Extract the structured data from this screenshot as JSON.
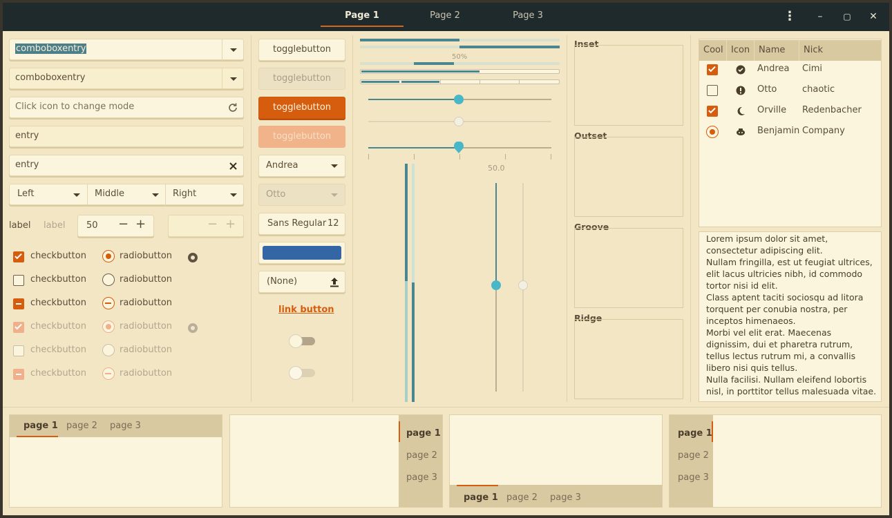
{
  "header": {
    "tabs": [
      {
        "label": "Page 1"
      },
      {
        "label": "Page 2"
      },
      {
        "label": "Page 3"
      }
    ],
    "controls": {
      "menu": "⋮",
      "minimize": "–",
      "maximize": "▢",
      "close": "✕"
    }
  },
  "left": {
    "combo1": "comboboxentry",
    "combo2": "comboboxentry",
    "mode_placeholder": "Click icon to change mode",
    "entry1": "entry",
    "entry2": "entry",
    "seg": [
      "Left",
      "Middle",
      "Right"
    ],
    "label1": "label",
    "label2": "label",
    "spin_value": "50",
    "checks": [
      {
        "label": "checkbutton",
        "state": "checked"
      },
      {
        "label": "checkbutton",
        "state": "unchecked"
      },
      {
        "label": "checkbutton",
        "state": "mixed"
      },
      {
        "label": "checkbutton",
        "state": "checked-disabled"
      },
      {
        "label": "checkbutton",
        "state": "unchecked-disabled"
      },
      {
        "label": "checkbutton",
        "state": "mixed-disabled"
      }
    ],
    "radios": [
      {
        "label": "radiobutton"
      },
      {
        "label": "radiobutton"
      },
      {
        "label": "radiobutton"
      },
      {
        "label": "radiobutton"
      },
      {
        "label": "radiobutton"
      },
      {
        "label": "radiobutton"
      }
    ]
  },
  "buttons": {
    "toggle": [
      "togglebutton",
      "togglebutton",
      "togglebutton",
      "togglebutton"
    ],
    "combo_active": "Andrea",
    "combo_disabled": "Otto",
    "font_name": "Sans Regular",
    "font_size": "12",
    "color_value": "#3465a4",
    "file_none": "(None)",
    "link": "link button",
    "switch1": "off",
    "switch2": "off-disabled"
  },
  "sliders": {
    "progress_label": "50%",
    "progress_value": 0.5,
    "hscale_value": 0.5,
    "vscale_label": "50.0"
  },
  "frames": {
    "titles": [
      "Inset",
      "Outset",
      "Groove",
      "Ridge"
    ]
  },
  "tree": {
    "columns": [
      "Cool",
      "Icon",
      "Name",
      "Nick"
    ],
    "rows": [
      {
        "cool": "checked",
        "icon": "check-circle-icon",
        "name": "Andrea",
        "nick": "Cimi"
      },
      {
        "cool": "unchecked",
        "icon": "alert-circle-icon",
        "name": "Otto",
        "nick": "chaotic"
      },
      {
        "cool": "checked",
        "icon": "moon-icon",
        "name": "Orville",
        "nick": "Redenbacher"
      },
      {
        "cool": "radio",
        "icon": "bot-icon",
        "name": "Benjamin",
        "nick": "Company"
      }
    ]
  },
  "text": {
    "lines": [
      "Lorem ipsum dolor sit amet,",
      "consectetur adipiscing elit.",
      "Nullam fringilla, est ut feugiat ultrices,",
      "elit lacus ultricies nibh, id commodo",
      "tortor nisi id elit.",
      "Class aptent taciti sociosqu ad litora",
      "torquent per conubia nostra, per",
      "inceptos himenaeos.",
      "Morbi vel elit erat. Maecenas",
      "dignissim, dui et pharetra rutrum,",
      "tellus lectus rutrum mi, a convallis",
      "libero nisi quis tellus.",
      "Nulla facilisi. Nullam eleifend lobortis",
      "nisl, in porttitor tellus malesuada vitae."
    ]
  },
  "notebooks": {
    "tabs": [
      "page 1",
      "page 2",
      "page 3"
    ]
  },
  "colors": {
    "accent": "#d65d0e",
    "teal": "#4a8690",
    "knob": "#4ab7c9"
  }
}
